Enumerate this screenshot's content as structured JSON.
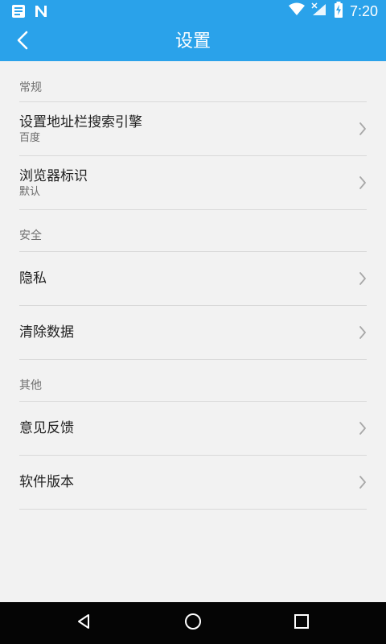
{
  "status_bar": {
    "time": "7:20",
    "icons": [
      "notes-icon",
      "n-icon",
      "wifi-icon",
      "signal-off-icon",
      "battery-charging-icon"
    ]
  },
  "app_bar": {
    "title": "设置",
    "back_icon": "chevron-left-icon"
  },
  "sections": [
    {
      "header": "常规",
      "items": [
        {
          "title": "设置地址栏搜索引擎",
          "subtitle": "百度"
        },
        {
          "title": "浏览器标识",
          "subtitle": "默认"
        }
      ]
    },
    {
      "header": "安全",
      "items": [
        {
          "title": "隐私",
          "subtitle": ""
        },
        {
          "title": "清除数据",
          "subtitle": ""
        }
      ]
    },
    {
      "header": "其他",
      "items": [
        {
          "title": "意见反馈",
          "subtitle": ""
        },
        {
          "title": "软件版本",
          "subtitle": ""
        }
      ]
    }
  ],
  "navigation_bar": {
    "icons": [
      "back-triangle-icon",
      "home-circle-icon",
      "recents-square-icon"
    ]
  },
  "colors": {
    "primary": "#2aa2ea",
    "background": "#f2f2f2",
    "divider": "#d9d9d9",
    "text_primary": "#222222",
    "text_secondary": "#6a6a6a"
  }
}
